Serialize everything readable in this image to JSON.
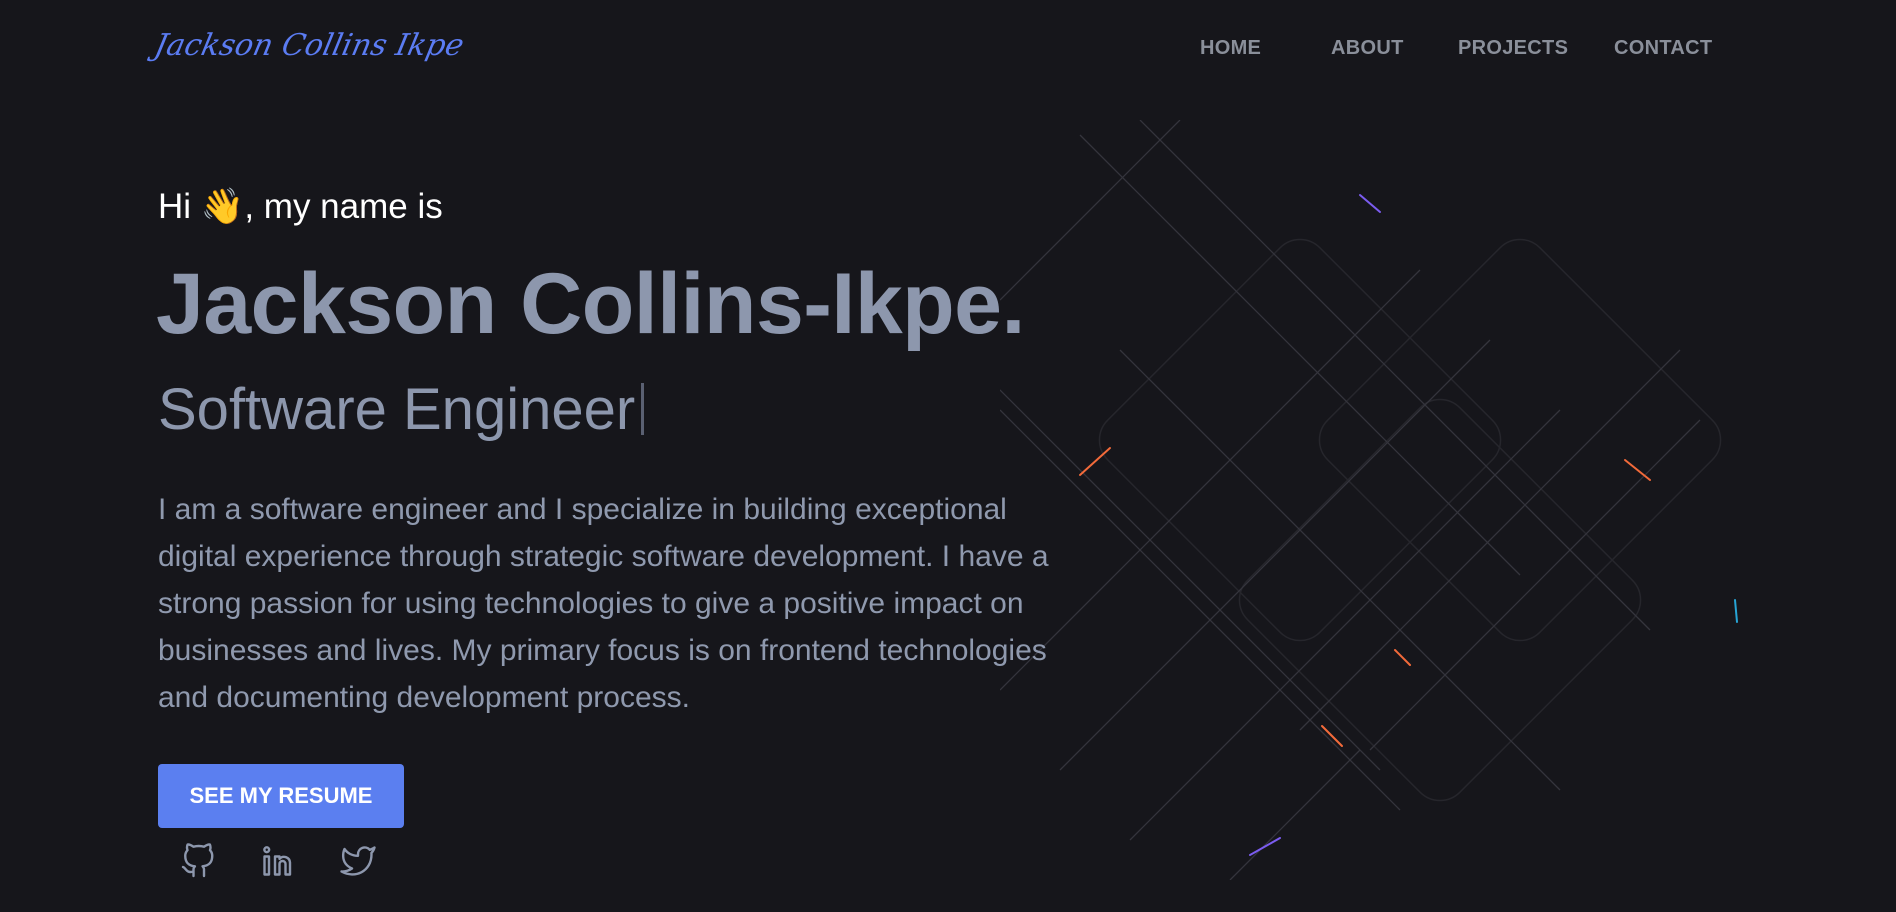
{
  "logo": {
    "text": "Jackson Collins Ikpe"
  },
  "nav": {
    "items": [
      {
        "label": "HOME"
      },
      {
        "label": "ABOUT"
      },
      {
        "label": "PROJECTS"
      },
      {
        "label": "CONTACT"
      }
    ]
  },
  "hero": {
    "greeting": "Hi 👋, my name is",
    "name": "Jackson Collins-Ikpe.",
    "role": "Software Engineer",
    "intro_lines": [
      "I am a software engineer and I specialize in building exceptional",
      "digital experience through strategic software development. I have a",
      "strong passion for using technologies to give a positive impact on",
      "businesses and lives. My primary focus is on frontend technologies",
      "and documenting development process."
    ],
    "resume_button": "SEE MY RESUME"
  },
  "social": [
    {
      "icon": "github-icon"
    },
    {
      "icon": "linkedin-icon"
    },
    {
      "icon": "twitter-icon"
    }
  ],
  "colors": {
    "background": "#16161b",
    "accent": "#5b7ff0",
    "text_muted": "#8d97ad",
    "nav_text": "#8a8f9a"
  }
}
